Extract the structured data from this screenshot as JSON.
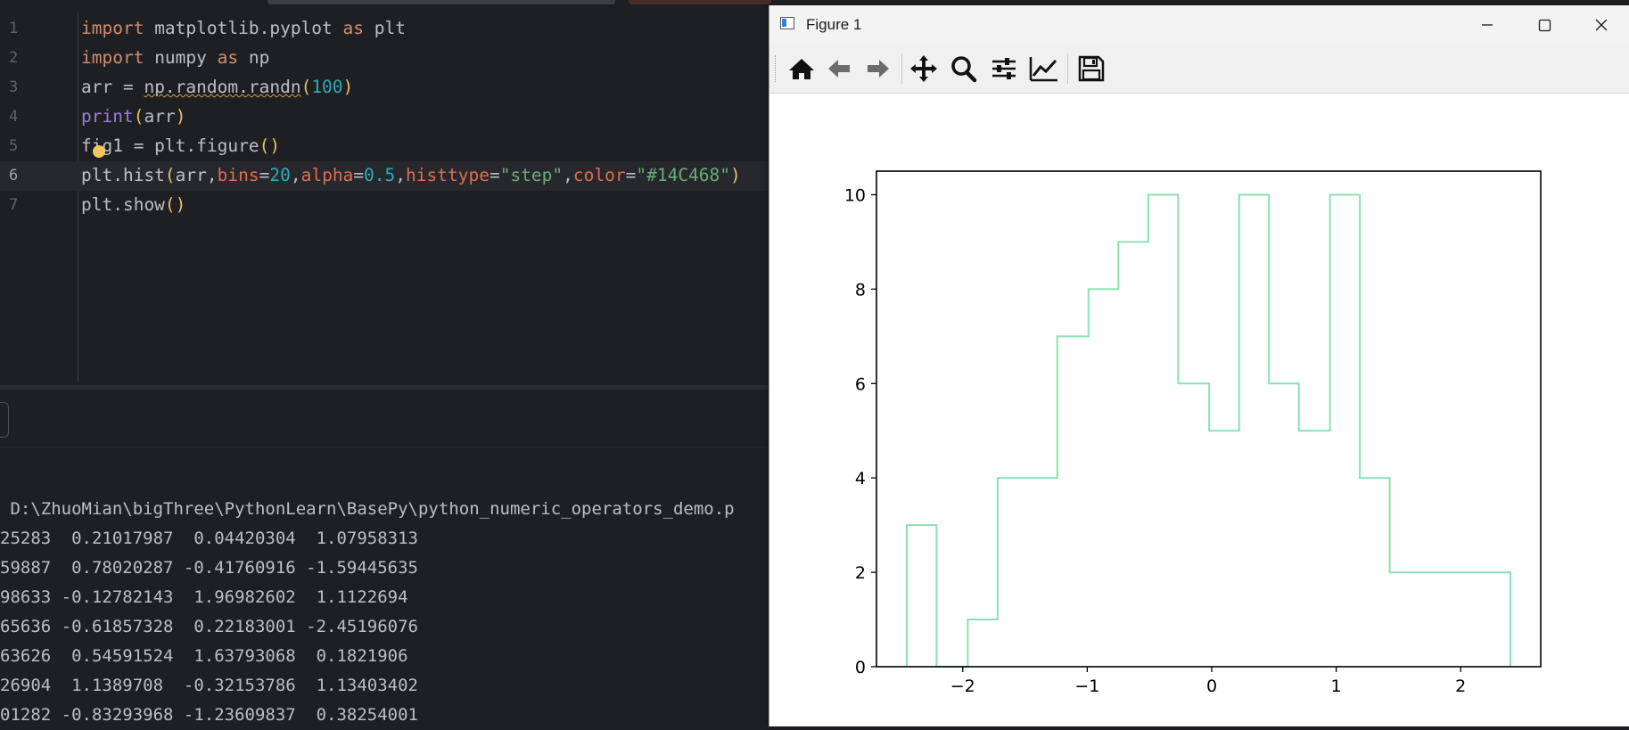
{
  "editor": {
    "lines": [
      {
        "n": "1"
      },
      {
        "n": "2"
      },
      {
        "n": "3"
      },
      {
        "n": "4"
      },
      {
        "n": "5"
      },
      {
        "n": "6"
      },
      {
        "n": "7"
      }
    ],
    "code": {
      "l1_kw1": "import",
      "l1_mod": " matplotlib.pyplot ",
      "l1_kw2": "as",
      "l1_alias": " plt",
      "l2_kw1": "import",
      "l2_mod": " numpy ",
      "l2_kw2": "as",
      "l2_alias": " np",
      "l3_a": "arr = ",
      "l3_call": "np.random.randn",
      "l3_p1": "(",
      "l3_n": "100",
      "l3_p2": ")",
      "l4_fn": "print",
      "l4_p1": "(",
      "l4_arg": "arr",
      "l4_p2": ")",
      "l5_a": "fig1 = plt.figure",
      "l5_p": "()",
      "l6_a": "plt.hist",
      "l6_p1": "(",
      "l6_b": "arr,",
      "l6_k1": "bins",
      "l6_e1": "=",
      "l6_v1": "20",
      "l6_c1": ",",
      "l6_k2": "alpha",
      "l6_e2": "=",
      "l6_v2": "0.5",
      "l6_c2": ",",
      "l6_k3": "histtype",
      "l6_e3": "=",
      "l6_v3": "\"step\"",
      "l6_c3": ",",
      "l6_k4": "color",
      "l6_e4": "=",
      "l6_v4": "\"#14C468\"",
      "l6_p2": ")",
      "l7_a": "plt.show",
      "l7_p": "()"
    }
  },
  "console": {
    "path": " D:\\ZhuoMian\\bigThree\\PythonLearn\\BasePy\\python_numeric_operators_demo.p",
    "rows": [
      "25283  0.21017987  0.04420304  1.07958313",
      "59887  0.78020287 -0.41760916 -1.59445635",
      "98633 -0.12782143  1.96982602  1.1122694",
      "65636 -0.61857328  0.22183001 -2.45196076",
      "63626  0.54591524  1.63793068  0.1821906",
      "26904  1.1389708  -0.32153786  1.13403402",
      "01282 -0.83293968 -1.23609837  0.38254001"
    ]
  },
  "figure_window": {
    "title": "Figure 1",
    "toolbar": [
      "home-icon",
      "back-icon",
      "forward-icon",
      "pan-icon",
      "zoom-icon",
      "configure-subplots-icon",
      "edit-axis-icon",
      "save-icon"
    ]
  },
  "chart_data": {
    "type": "histogram-step",
    "color": "#14C468",
    "alpha": 0.5,
    "bin_edges": [
      -2.45,
      -2.21,
      -1.96,
      -1.72,
      -1.48,
      -1.24,
      -0.99,
      -0.75,
      -0.51,
      -0.27,
      -0.02,
      0.22,
      0.46,
      0.7,
      0.95,
      1.19,
      1.43,
      1.67,
      1.91,
      2.16,
      2.4
    ],
    "counts": [
      3,
      0,
      1,
      4,
      4,
      7,
      8,
      9,
      10,
      6,
      5,
      10,
      6,
      5,
      10,
      4,
      2,
      2,
      2,
      2
    ],
    "xticks": [
      -2,
      -1,
      0,
      1,
      2
    ],
    "xtick_labels": [
      "−2",
      "−1",
      "0",
      "1",
      "2"
    ],
    "yticks": [
      0,
      2,
      4,
      6,
      8,
      10
    ],
    "yticks_labels": [
      "0",
      "2",
      "4",
      "6",
      "8",
      "10"
    ],
    "xlim": [
      -2.693,
      2.643
    ],
    "ylim": [
      0,
      10.5
    ],
    "xlabel": "",
    "ylabel": "",
    "title": ""
  }
}
